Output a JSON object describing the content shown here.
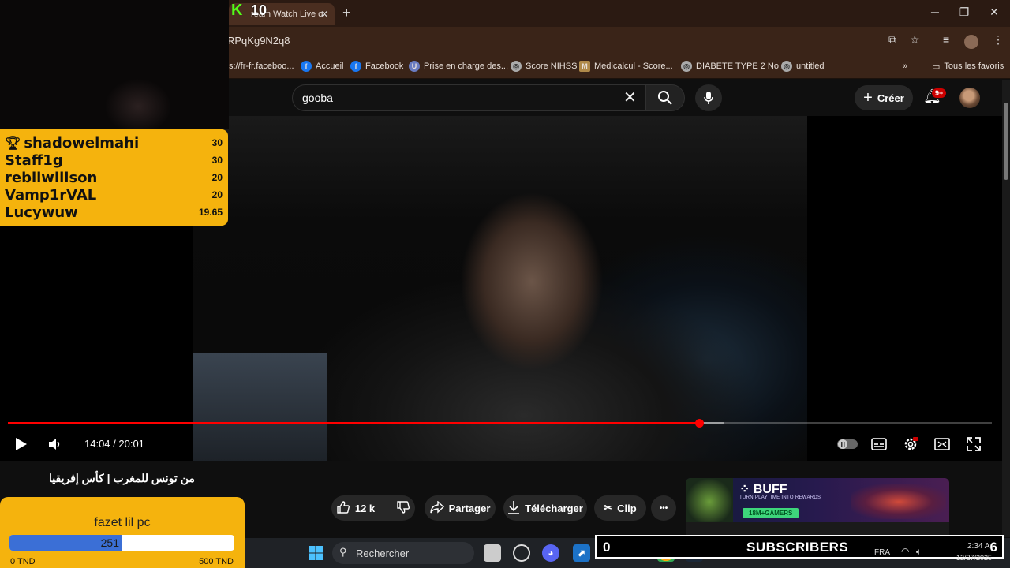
{
  "browser": {
    "tab_title": "Watch Live o",
    "tab_prefix": "ream",
    "url": "RPqKg9N2q8",
    "bookmarks": [
      "s://fr-fr.faceboo...",
      "Accueil",
      "Facebook",
      "Prise en charge des...",
      "Score NIHSS",
      "Medicalcul - Score...",
      "DIABETE TYPE 2 No...",
      "untitled"
    ],
    "all_bookmarks": "Tous les favoris",
    "more": "»"
  },
  "youtube": {
    "search_value": "gooba",
    "create_label": "Créer",
    "notif_badge": "9+",
    "video_title": "من تونس للمغرب | كأس إفريقيا",
    "time": "14:04 / 20:01",
    "progress": 0.7026,
    "buffered": 0.7282,
    "likes": "12 k",
    "share_label": "Partager",
    "download_label": "Télécharger",
    "clip_label": "Clip",
    "more_label": "•••"
  },
  "ad": {
    "brand": "BUFF",
    "tagline": "TURN PLAYTIME INTO REWARDS",
    "cta": "18M+GAMERS"
  },
  "kick_overlay": {
    "logo": "K",
    "number": "10"
  },
  "leaderboard": [
    {
      "name": "shadowelmahi",
      "value": "30",
      "trophy": true
    },
    {
      "name": "Staff1g",
      "value": "30"
    },
    {
      "name": "rebiiwillson",
      "value": "20"
    },
    {
      "name": "Vamp1rVAL",
      "value": "20"
    },
    {
      "name": "Lucywuw",
      "value": "19.65"
    }
  ],
  "goal": {
    "title": "fazet lil pc",
    "current": "251",
    "fraction": 0.502,
    "min_label": "0 TND",
    "max_label": "500 TND"
  },
  "taskbar": {
    "search_placeholder": "Rechercher",
    "lang": "FRA",
    "clock_time": "2:34 A",
    "clock_date": "12/27/2025"
  },
  "subscribers": {
    "count": "0",
    "label": "SUBSCRIBERS",
    "goal": "6"
  },
  "colors": {
    "progress": "#ff0000",
    "widget": "#f5b30d",
    "goal_fill": "#3b6fd6",
    "kick_green": "#53fc18"
  }
}
